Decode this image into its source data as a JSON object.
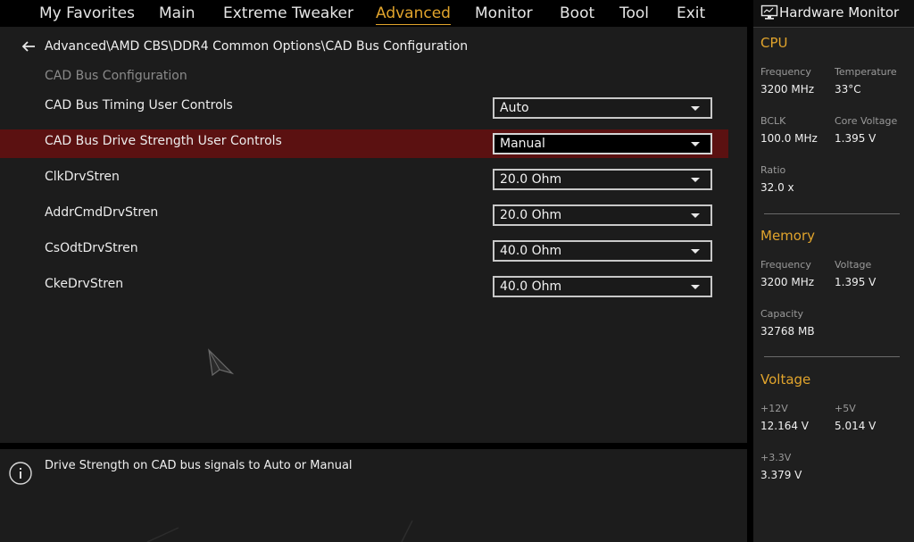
{
  "menu": {
    "items": [
      {
        "label": "My Favorites"
      },
      {
        "label": "Main"
      },
      {
        "label": "Extreme Tweaker"
      },
      {
        "label": "Advanced"
      },
      {
        "label": "Monitor"
      },
      {
        "label": "Boot"
      },
      {
        "label": "Tool"
      },
      {
        "label": "Exit"
      }
    ],
    "active": "Advanced",
    "accent_color": "#e1a42c"
  },
  "breadcrumb": {
    "path": "Advanced\\AMD CBS\\DDR4 Common Options\\CAD Bus Configuration",
    "back_icon": "arrow-left-icon"
  },
  "section_title": "CAD Bus Configuration",
  "settings": [
    {
      "label": "CAD Bus Timing User Controls",
      "value": "Auto",
      "selected": false
    },
    {
      "label": "CAD Bus Drive Strength User Controls",
      "value": "Manual",
      "selected": true
    },
    {
      "label": "ClkDrvStren",
      "value": "20.0 Ohm",
      "selected": false
    },
    {
      "label": "AddrCmdDrvStren",
      "value": "20.0 Ohm",
      "selected": false
    },
    {
      "label": "CsOdtDrvStren",
      "value": "40.0 Ohm",
      "selected": false
    },
    {
      "label": "CkeDrvStren",
      "value": "40.0 Ohm",
      "selected": false
    }
  ],
  "help": {
    "icon": "info-icon",
    "text": "Drive Strength on CAD bus signals to Auto or Manual"
  },
  "hardware_monitor": {
    "title": "Hardware Monitor",
    "icon": "monitor-icon",
    "cpu": {
      "title": "CPU",
      "frequency_label": "Frequency",
      "frequency_value": "3200 MHz",
      "temperature_label": "Temperature",
      "temperature_value": "33°C",
      "bclk_label": "BCLK",
      "bclk_value": "100.0 MHz",
      "core_voltage_label": "Core Voltage",
      "core_voltage_value": "1.395 V",
      "ratio_label": "Ratio",
      "ratio_value": "32.0 x"
    },
    "memory": {
      "title": "Memory",
      "frequency_label": "Frequency",
      "frequency_value": "3200 MHz",
      "voltage_label": "Voltage",
      "voltage_value": "1.395 V",
      "capacity_label": "Capacity",
      "capacity_value": "32768 MB"
    },
    "voltage": {
      "title": "Voltage",
      "v12_label": "+12V",
      "v12_value": "12.164 V",
      "v5_label": "+5V",
      "v5_value": "5.014 V",
      "v33_label": "+3.3V",
      "v33_value": "3.379 V"
    }
  },
  "colors": {
    "selected_row": "#5b1111",
    "panel_bg": "#1c1c1c",
    "accent": "#e1a42c"
  }
}
